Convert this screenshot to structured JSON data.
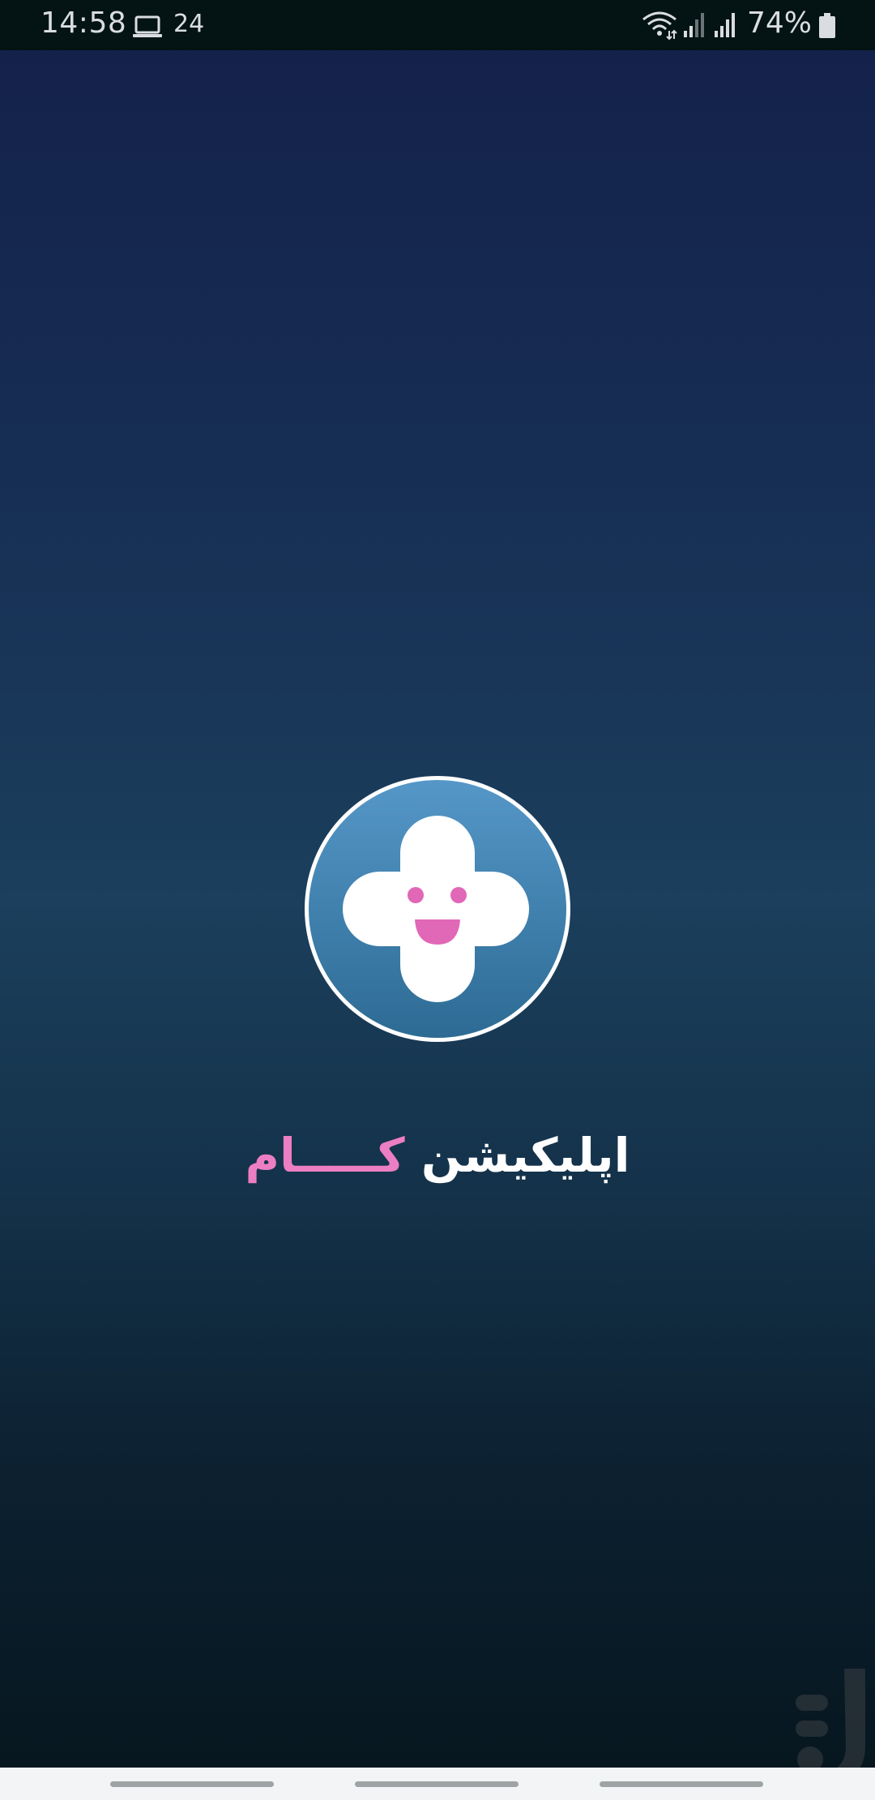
{
  "status_bar": {
    "time": "14:58",
    "notification_count": "24",
    "battery_percent": "74%",
    "icons": [
      "laptop-icon",
      "wifi-icon",
      "signal-icon",
      "signal-icon",
      "battery-icon"
    ]
  },
  "splash": {
    "logo_icon": "plus-smiley-logo-icon",
    "app_name_part1": "اپلیکیشن",
    "app_name_part2": "کـــــام",
    "colors": {
      "accent_pink": "#ec7ec3",
      "logo_blue": "#4a8bbb",
      "background_top": "#13204a",
      "background_bottom": "#06161e"
    }
  },
  "watermark": {
    "icon": "store-watermark-icon"
  },
  "nav_bar": {
    "handles": [
      "recent-apps",
      "home",
      "back"
    ]
  }
}
